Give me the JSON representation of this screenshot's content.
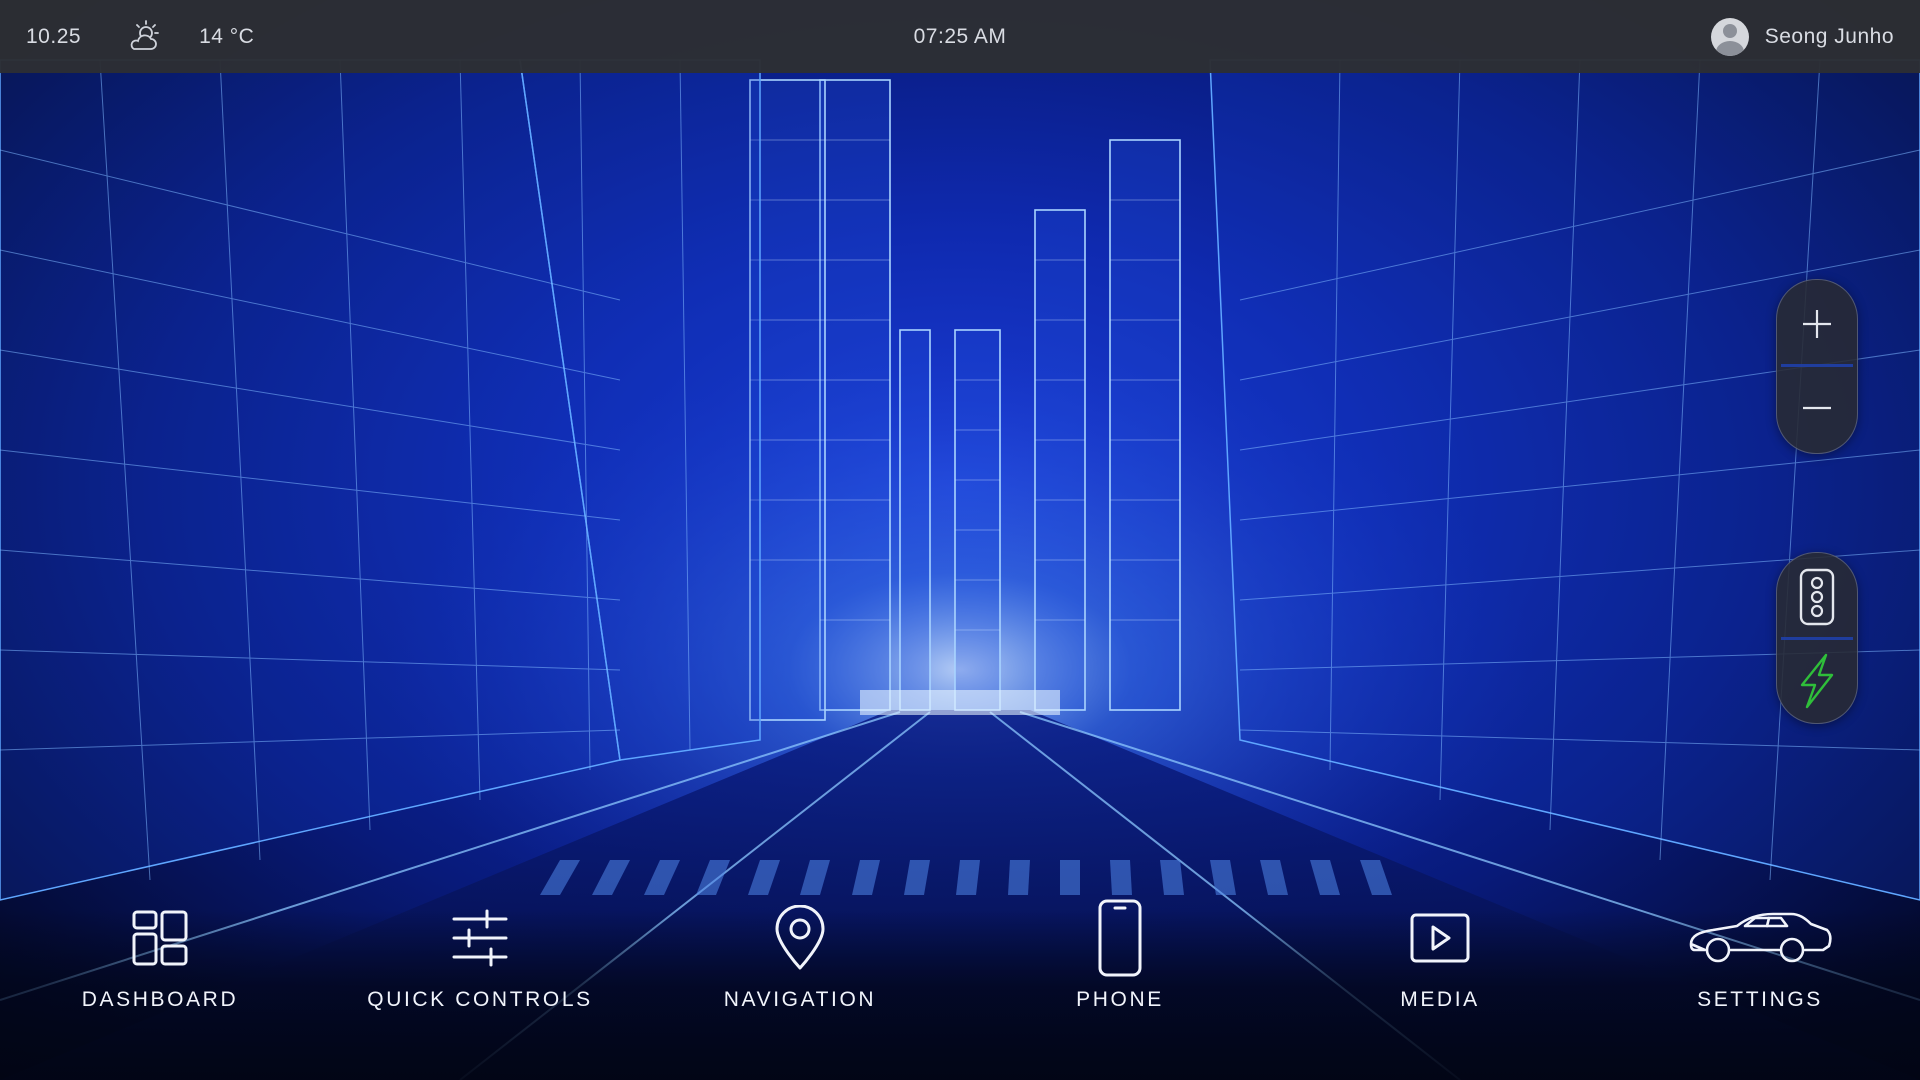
{
  "status_bar": {
    "temperature_reading": "10.25",
    "weather_icon": "partly-cloudy-sun-icon",
    "outside_temp": "14 °C",
    "clock": "07:25 AM",
    "user_name": "Seong Junho",
    "user_icon": "user-avatar-icon"
  },
  "map_controls": {
    "zoom_in_icon": "plus-icon",
    "zoom_out_icon": "minus-icon",
    "traffic_icon": "traffic-light-icon",
    "charging_icon": "lightning-bolt-icon",
    "charging_color": "#2fbf3a"
  },
  "dock": {
    "items": [
      {
        "label": "DASHBOARD",
        "icon": "dashboard-grid-icon"
      },
      {
        "label": "QUICK CONTROLS",
        "icon": "sliders-icon"
      },
      {
        "label": "NAVIGATION",
        "icon": "location-pin-icon"
      },
      {
        "label": "PHONE",
        "icon": "smartphone-icon"
      },
      {
        "label": "MEDIA",
        "icon": "play-icon"
      },
      {
        "label": "SETTINGS",
        "icon": "car-icon"
      }
    ]
  },
  "theme": {
    "background_accent": "#1b3dd6",
    "wireframe_color": "#6fb4ff",
    "bar_color": "#2c2e34",
    "text_color": "#e8ecf5"
  }
}
